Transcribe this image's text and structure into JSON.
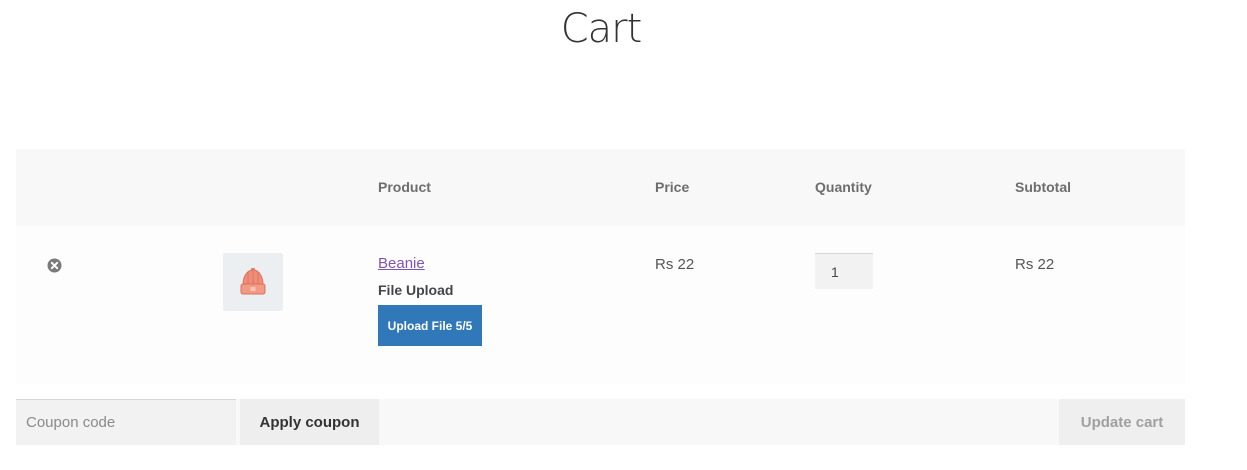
{
  "page": {
    "title": "Cart"
  },
  "cart": {
    "columns": {
      "product": "Product",
      "price": "Price",
      "quantity": "Quantity",
      "subtotal": "Subtotal"
    },
    "items": [
      {
        "name": "Beanie",
        "meta_label": "File Upload",
        "upload_button": "Upload File 5/5",
        "price": "Rs 22",
        "quantity": "1",
        "subtotal": "Rs 22",
        "remove_icon": "remove-circle-x-icon",
        "thumbnail_icon": "beanie-hat-image"
      }
    ],
    "actions": {
      "coupon_placeholder": "Coupon code",
      "apply_label": "Apply coupon",
      "update_label": "Update cart"
    }
  },
  "colors": {
    "link": "#7f54b3",
    "upload_button": "#3178b8",
    "header_bg": "#f8f8f8"
  }
}
